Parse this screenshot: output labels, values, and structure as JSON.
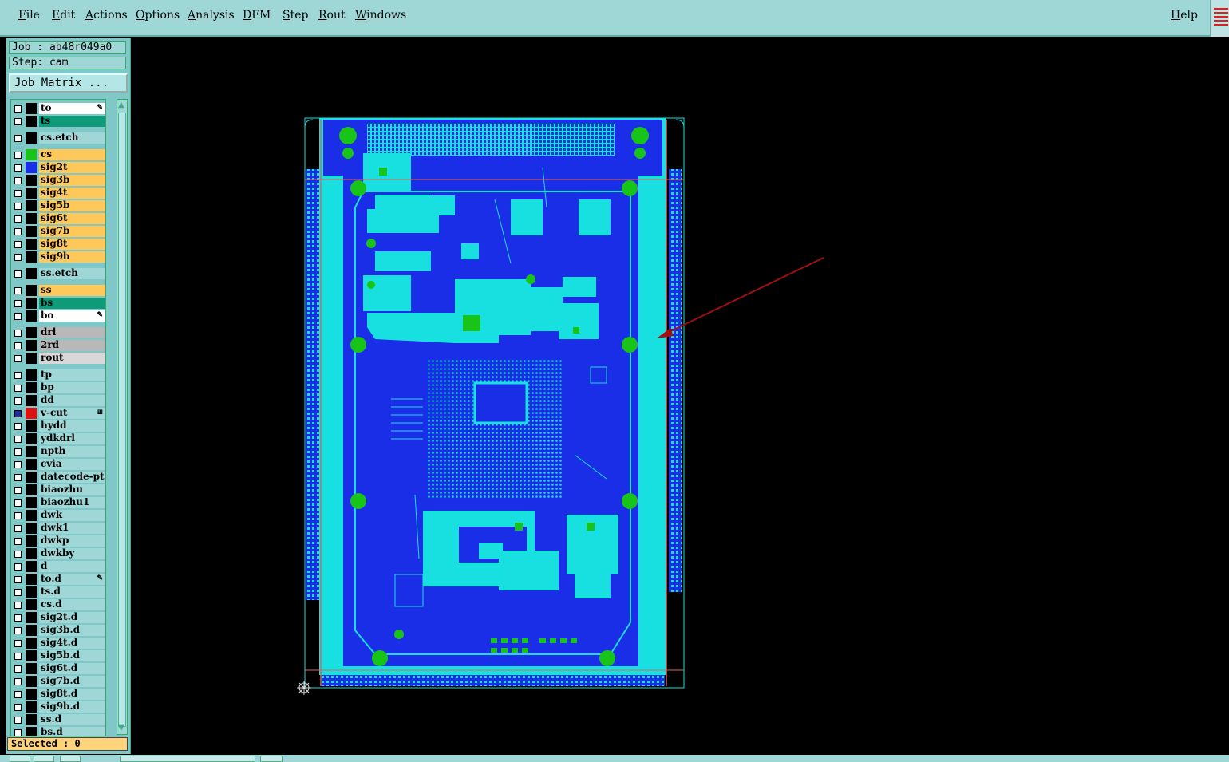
{
  "menubar": {
    "items": [
      "File",
      "Edit",
      "Actions",
      "Options",
      "Analysis",
      "DFM",
      "Step",
      "Rout",
      "Windows"
    ],
    "help": "Help"
  },
  "panel": {
    "job": "Job : ab48r049a0",
    "step": "Step: cam",
    "job_matrix": "Job Matrix ...",
    "selected": "Selected : 0"
  },
  "layers": [
    {
      "name": "to",
      "color": "#ffffff",
      "swatch": "#000000",
      "mark": "pen"
    },
    {
      "name": "ts",
      "color": "#0f9a7a",
      "swatch": "#000000"
    },
    {
      "name": "cs.etch",
      "color": "#9fd6d6",
      "swatch": "#000000",
      "gap": true
    },
    {
      "name": "cs",
      "color": "#ffc85a",
      "swatch": "#19c419",
      "gap": true
    },
    {
      "name": "sig2t",
      "color": "#ffc85a",
      "swatch": "#1a2ee8"
    },
    {
      "name": "sig3b",
      "color": "#ffc85a",
      "swatch": "#000000"
    },
    {
      "name": "sig4t",
      "color": "#ffc85a",
      "swatch": "#000000"
    },
    {
      "name": "sig5b",
      "color": "#ffc85a",
      "swatch": "#000000"
    },
    {
      "name": "sig6t",
      "color": "#ffc85a",
      "swatch": "#000000"
    },
    {
      "name": "sig7b",
      "color": "#ffc85a",
      "swatch": "#000000"
    },
    {
      "name": "sig8t",
      "color": "#ffc85a",
      "swatch": "#000000"
    },
    {
      "name": "sig9b",
      "color": "#ffc85a",
      "swatch": "#000000"
    },
    {
      "name": "ss.etch",
      "color": "#9fd6d6",
      "swatch": "#000000",
      "gap": true
    },
    {
      "name": "ss",
      "color": "#ffc85a",
      "swatch": "#000000",
      "gap": true
    },
    {
      "name": "bs",
      "color": "#0f9a7a",
      "swatch": "#000000"
    },
    {
      "name": "bo",
      "color": "#ffffff",
      "swatch": "#000000",
      "mark": "pen"
    },
    {
      "name": "drl",
      "color": "#b8b8b8",
      "swatch": "#000000",
      "gap": true
    },
    {
      "name": "2rd",
      "color": "#b8b8b8",
      "swatch": "#000000"
    },
    {
      "name": "rout",
      "color": "#d8d8d8",
      "swatch": "#000000"
    },
    {
      "name": "tp",
      "color": "#9fd6d6",
      "swatch": "#000000",
      "gap": true
    },
    {
      "name": "bp",
      "color": "#9fd6d6",
      "swatch": "#000000"
    },
    {
      "name": "dd",
      "color": "#9fd6d6",
      "swatch": "#000000"
    },
    {
      "name": "v-cut",
      "color": "#9fd6d6",
      "swatch": "#e01010",
      "check": "#1a2ea0",
      "mark": "grid"
    },
    {
      "name": "hydd",
      "color": "#9fd6d6",
      "swatch": "#000000"
    },
    {
      "name": "ydkdrl",
      "color": "#9fd6d6",
      "swatch": "#000000"
    },
    {
      "name": "npth",
      "color": "#9fd6d6",
      "swatch": "#000000"
    },
    {
      "name": "cvia",
      "color": "#9fd6d6",
      "swatch": "#000000"
    },
    {
      "name": "datecode-pte",
      "color": "#9fd6d6",
      "swatch": "#000000"
    },
    {
      "name": "biaozhu",
      "color": "#9fd6d6",
      "swatch": "#000000"
    },
    {
      "name": "biaozhu1",
      "color": "#9fd6d6",
      "swatch": "#000000"
    },
    {
      "name": "dwk",
      "color": "#9fd6d6",
      "swatch": "#000000"
    },
    {
      "name": "dwk1",
      "color": "#9fd6d6",
      "swatch": "#000000"
    },
    {
      "name": "dwkp",
      "color": "#9fd6d6",
      "swatch": "#000000"
    },
    {
      "name": "dwkby",
      "color": "#9fd6d6",
      "swatch": "#000000"
    },
    {
      "name": "d",
      "color": "#9fd6d6",
      "swatch": "#000000"
    },
    {
      "name": "to.d",
      "color": "#9fd6d6",
      "swatch": "#000000",
      "mark": "pen"
    },
    {
      "name": "ts.d",
      "color": "#9fd6d6",
      "swatch": "#000000"
    },
    {
      "name": "cs.d",
      "color": "#9fd6d6",
      "swatch": "#000000"
    },
    {
      "name": "sig2t.d",
      "color": "#9fd6d6",
      "swatch": "#000000"
    },
    {
      "name": "sig3b.d",
      "color": "#9fd6d6",
      "swatch": "#000000"
    },
    {
      "name": "sig4t.d",
      "color": "#9fd6d6",
      "swatch": "#000000"
    },
    {
      "name": "sig5b.d",
      "color": "#9fd6d6",
      "swatch": "#000000"
    },
    {
      "name": "sig6t.d",
      "color": "#9fd6d6",
      "swatch": "#000000"
    },
    {
      "name": "sig7b.d",
      "color": "#9fd6d6",
      "swatch": "#000000"
    },
    {
      "name": "sig8t.d",
      "color": "#9fd6d6",
      "swatch": "#000000"
    },
    {
      "name": "sig9b.d",
      "color": "#9fd6d6",
      "swatch": "#000000"
    },
    {
      "name": "ss.d",
      "color": "#9fd6d6",
      "swatch": "#000000"
    },
    {
      "name": "bs.d",
      "color": "#9fd6d6",
      "swatch": "#000000"
    }
  ],
  "colors": {
    "board_blue": "#1a2ee8",
    "copper_cyan": "#19e0e0",
    "pad_green": "#19c419",
    "outline_red": "#e06060",
    "annotation_arrow": "#a01010"
  }
}
